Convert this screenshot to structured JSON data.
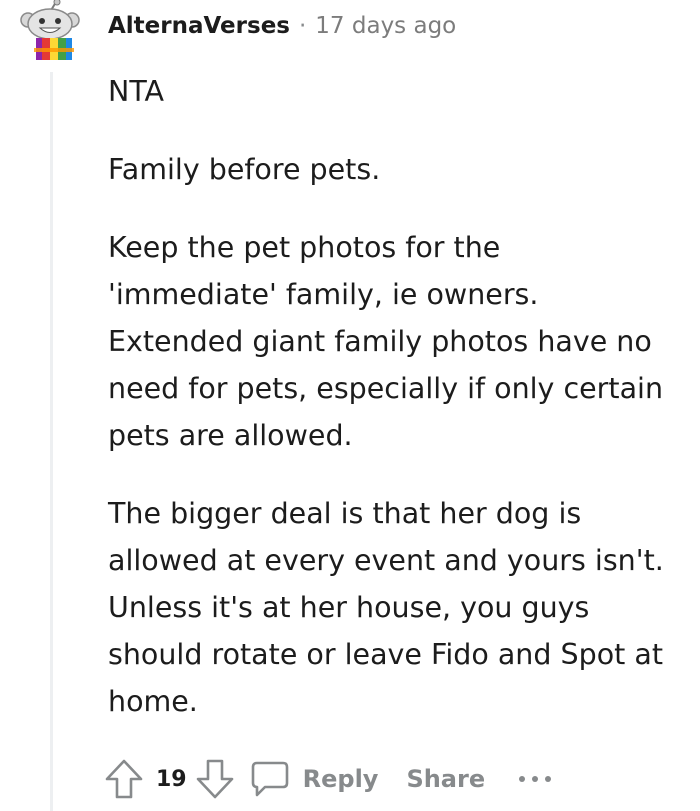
{
  "comment": {
    "username": "AlternaVerses",
    "separator": "·",
    "timestamp": "17 days ago",
    "paragraphs": [
      "NTA",
      "Family before pets.",
      "Keep the pet photos for the 'immediate' family, ie owners. Extended giant family photos have no need for pets, especially if only certain pets are allowed.",
      "The bigger deal is that her dog is allowed at every event and yours isn't. Unless it's at her house, you guys should rotate or leave Fido and Spot at home."
    ]
  },
  "actions": {
    "upvote_icon": "upvote-arrow-icon",
    "vote_count": "19",
    "downvote_icon": "downvote-arrow-icon",
    "comment_icon": "speech-bubble-icon",
    "reply_label": "Reply",
    "share_label": "Share",
    "more_icon": "ellipsis-icon"
  },
  "colors": {
    "text": "#1c1c1c",
    "meta": "#7c7c7c",
    "action": "#878a8c",
    "thread_line": "#edeff1"
  }
}
